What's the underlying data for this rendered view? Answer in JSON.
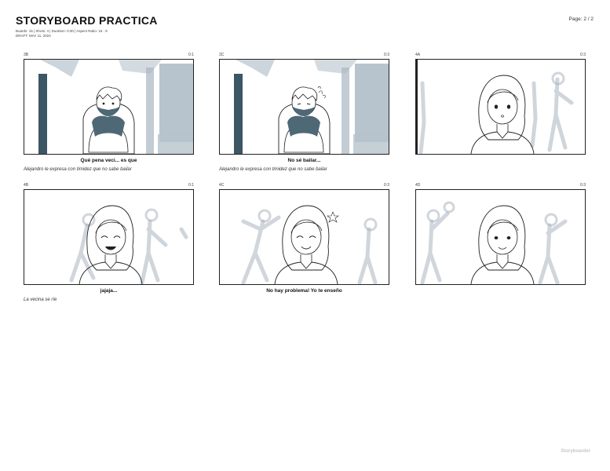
{
  "document": {
    "title": "STORYBOARD PRACTICA",
    "meta_line1": "Boards: 15  |  Shots: 4  |  Duration: 0:30  |  Aspect Ratio: 16 : 9",
    "meta_line2": "DRAFT: MAY 11, 2024",
    "page_label": "Page: 2 / 2",
    "footer_brand": "Storyboarder"
  },
  "panels": [
    {
      "number": "3B",
      "duration": "0:1",
      "dialogue": "Qué pena veci... es que",
      "action": "Alejandro le expresa con timidez que no sabe bailar"
    },
    {
      "number": "3C",
      "duration": "0:3",
      "dialogue": "No sé bailar...",
      "action": "Alejandro le expresa con timidez que no sabe bailar"
    },
    {
      "number": "4A",
      "duration": "0:3",
      "dialogue": "",
      "action": ""
    },
    {
      "number": "4B",
      "duration": "0:1",
      "dialogue": "jajaja...",
      "action": "La vecina se ríe"
    },
    {
      "number": "4C",
      "duration": "0:3",
      "dialogue": "No hay problema! Yo te enseño",
      "action": ""
    },
    {
      "number": "4D",
      "duration": "0:3",
      "dialogue": "",
      "action": ""
    }
  ],
  "colors": {
    "background_blocks": "#a9b7c2",
    "dark_pillar": "#3c5664",
    "shirt": "#4e6876",
    "blur_figures": "#a9b5bf"
  },
  "icons": [
    "boy-sketch",
    "girl-sketch",
    "blurred-dancers"
  ]
}
